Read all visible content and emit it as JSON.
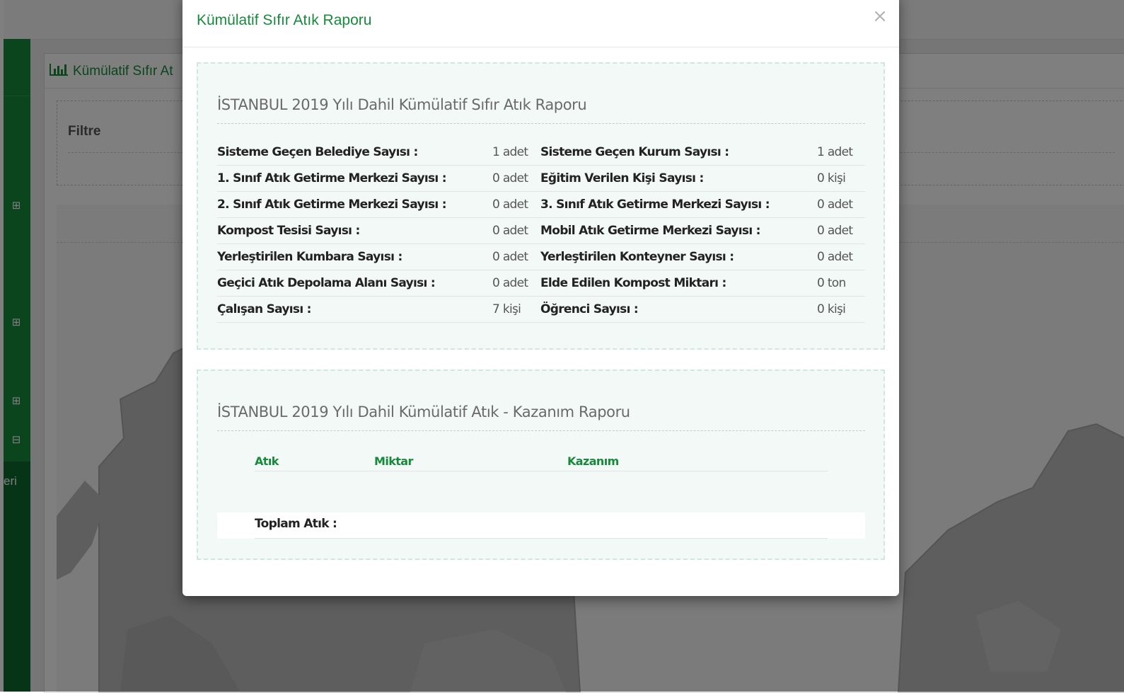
{
  "background": {
    "panel_title": "Kümülatif Sıfır At",
    "filter_title": "Filtre",
    "sidebar_text": "eri",
    "sidebar_buttons": [
      "⊞",
      "⊞",
      "⊞",
      "⊟"
    ]
  },
  "modal": {
    "title": "Kümülatif Sıfır Atık Raporu",
    "close_symbol": "×"
  },
  "report1": {
    "title": "İSTANBUL 2019 Yılı Dahil Kümülatif Sıfır Atık Raporu",
    "rows": [
      {
        "l1": "Sisteme Geçen Belediye Sayısı :",
        "v1": "1 adet",
        "l2": "Sisteme Geçen Kurum Sayısı :",
        "v2": "1 adet"
      },
      {
        "l1": "1. Sınıf Atık Getirme Merkezi Sayısı :",
        "v1": "0 adet",
        "l2": "Eğitim Verilen Kişi Sayısı :",
        "v2": "0 kişi"
      },
      {
        "l1": "2. Sınıf Atık Getirme Merkezi Sayısı :",
        "v1": "0 adet",
        "l2": "3. Sınıf Atık Getirme Merkezi Sayısı :",
        "v2": "0 adet"
      },
      {
        "l1": "Kompost Tesisi Sayısı :",
        "v1": "0 adet",
        "l2": "Mobil Atık Getirme Merkezi Sayısı :",
        "v2": "0 adet"
      },
      {
        "l1": "Yerleştirilen Kumbara Sayısı :",
        "v1": "0 adet",
        "l2": "Yerleştirilen Konteyner Sayısı :",
        "v2": "0 adet"
      },
      {
        "l1": "Geçici Atık Depolama Alanı Sayısı :",
        "v1": "0 adet",
        "l2": "Elde Edilen Kompost Miktarı :",
        "v2": "0 ton"
      },
      {
        "l1": "Çalışan Sayısı :",
        "v1": "7 kişi",
        "l2": "Öğrenci Sayısı :",
        "v2": "0 kişi"
      }
    ]
  },
  "report2": {
    "title": "İSTANBUL 2019 Yılı Dahil Kümülatif Atık - Kazanım Raporu",
    "columns": [
      "Atık",
      "Miktar",
      "Kazanım"
    ],
    "total_label": "Toplam Atık :"
  },
  "colors": {
    "brand_green": "#178a3c",
    "sidebar_dark": "#0b6a2c",
    "report_bg": "#f3f9f6"
  }
}
